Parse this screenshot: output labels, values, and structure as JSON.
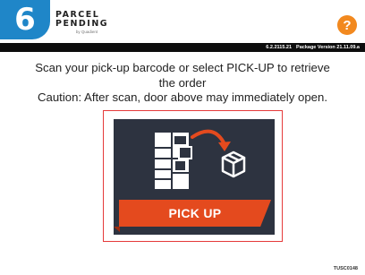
{
  "step": {
    "number": "6",
    "color": "#1f86c8"
  },
  "header": {
    "logo_word": "PARCEL PENDING",
    "logo_sub": "by Quadient",
    "help_label": "?",
    "help_icon": "question-mark-icon",
    "help_color": "#f2891f"
  },
  "version_bar": {
    "build": "6.2.2115.21",
    "package": "Package Version  21.11.09.a"
  },
  "instructions": {
    "line1": "Scan your pick-up barcode or select PICK-UP to retrieve",
    "line2": "the order",
    "line3": "Caution: After scan, door above may immediately open."
  },
  "pickup": {
    "label": "PICK UP",
    "frame_color": "#e53a3a",
    "tile_color": "#2d3340",
    "banner_color": "#e44a1e",
    "icons": [
      "locker-icon",
      "curved-arrow-icon",
      "package-box-icon"
    ]
  },
  "footer": {
    "device_id": "TUSC0148"
  }
}
